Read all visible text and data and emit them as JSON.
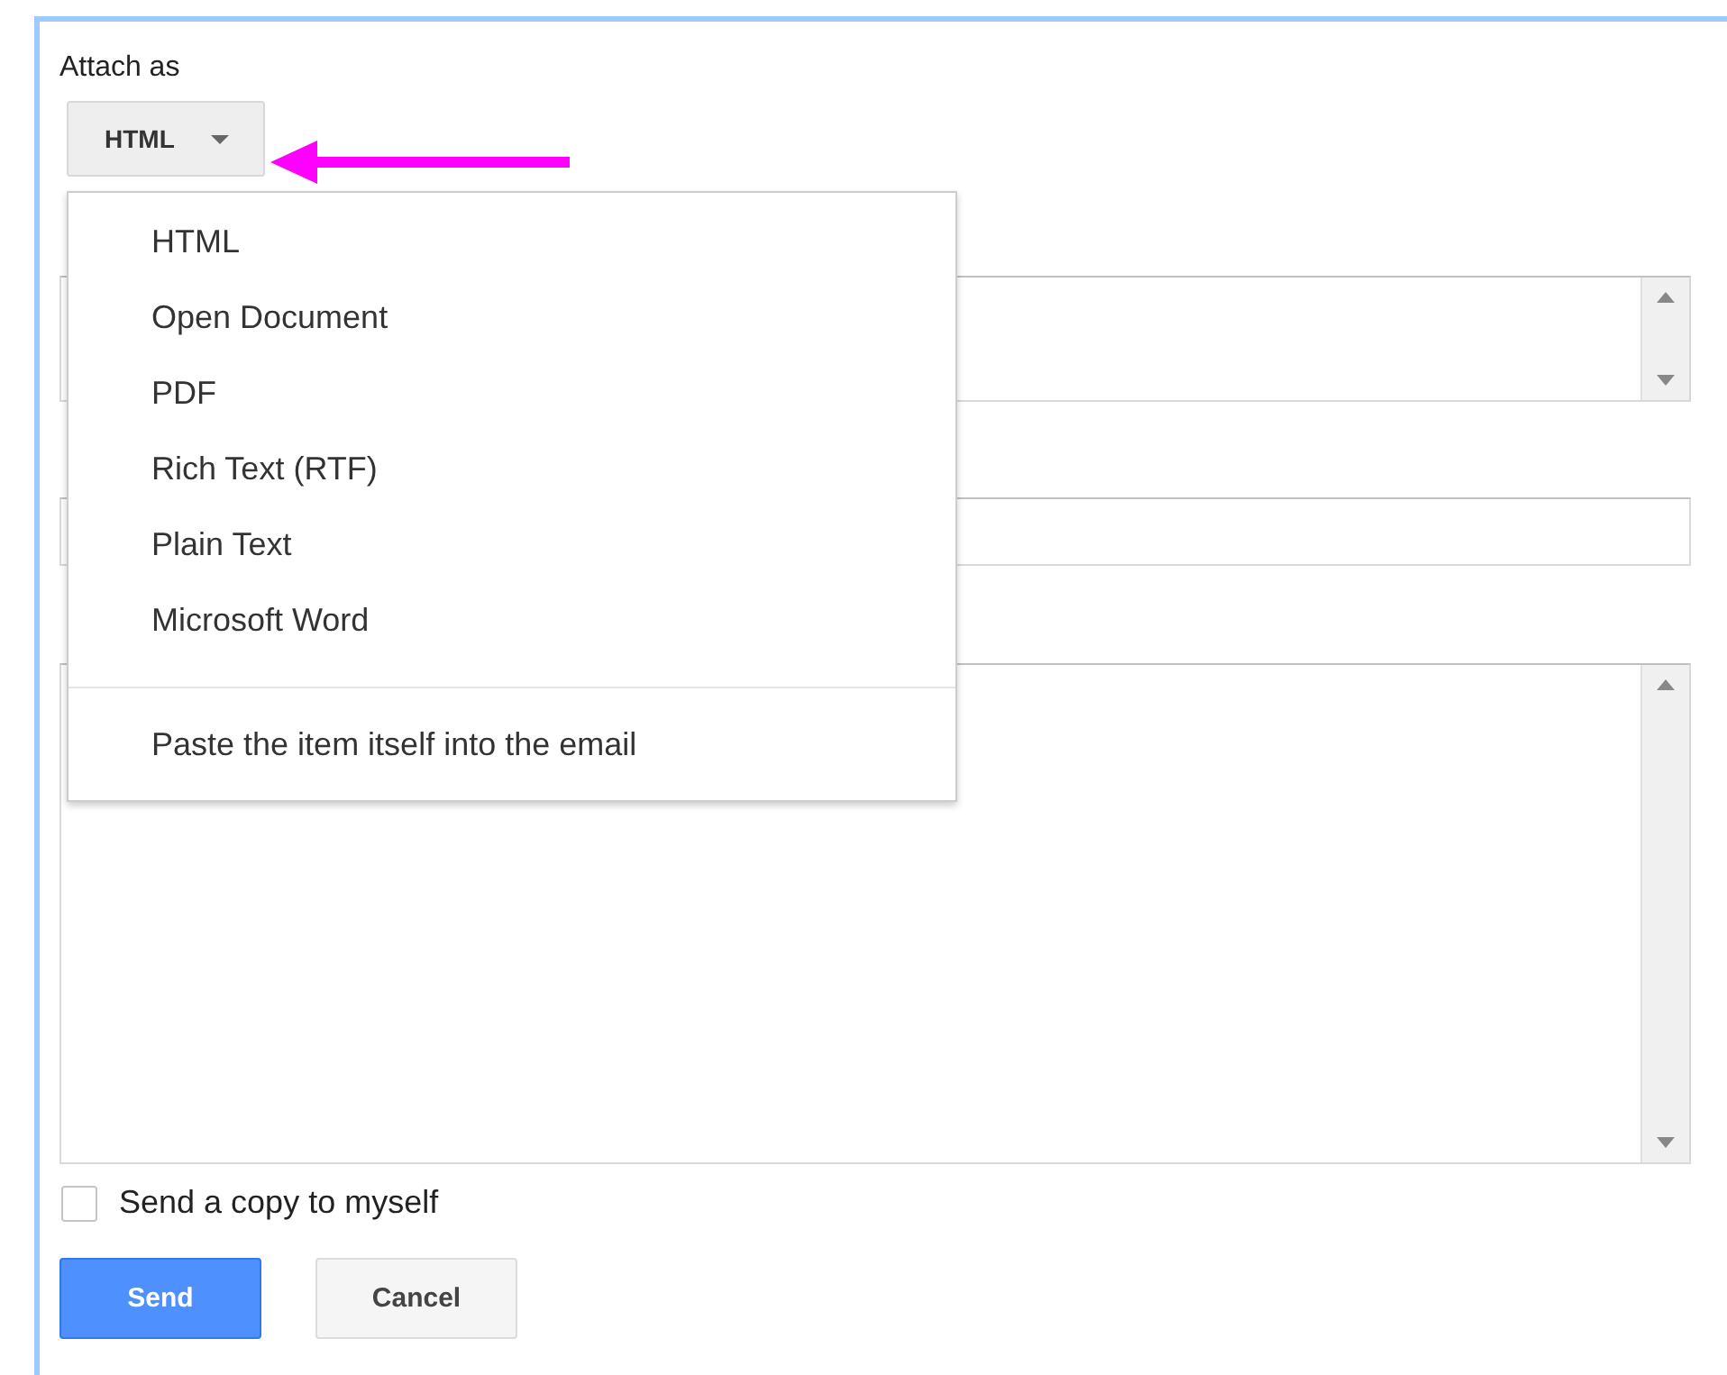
{
  "attach_label": "Attach as",
  "format_dropdown": {
    "value": "HTML",
    "expanded": true
  },
  "menu": {
    "items": [
      {
        "kind": "option",
        "label": "HTML"
      },
      {
        "kind": "option",
        "label": "Open Document"
      },
      {
        "kind": "option",
        "label": "PDF"
      },
      {
        "kind": "option",
        "label": "Rich Text (RTF)"
      },
      {
        "kind": "option",
        "label": "Plain Text"
      },
      {
        "kind": "option",
        "label": "Microsoft Word"
      },
      {
        "kind": "separator"
      },
      {
        "kind": "option",
        "label": "Paste the item itself into the email"
      }
    ]
  },
  "send_copy": {
    "label": "Send a copy to myself",
    "checked": false
  },
  "buttons": [
    {
      "kind": "primary",
      "label": "Send"
    },
    {
      "kind": "secondary",
      "label": "Cancel"
    }
  ]
}
